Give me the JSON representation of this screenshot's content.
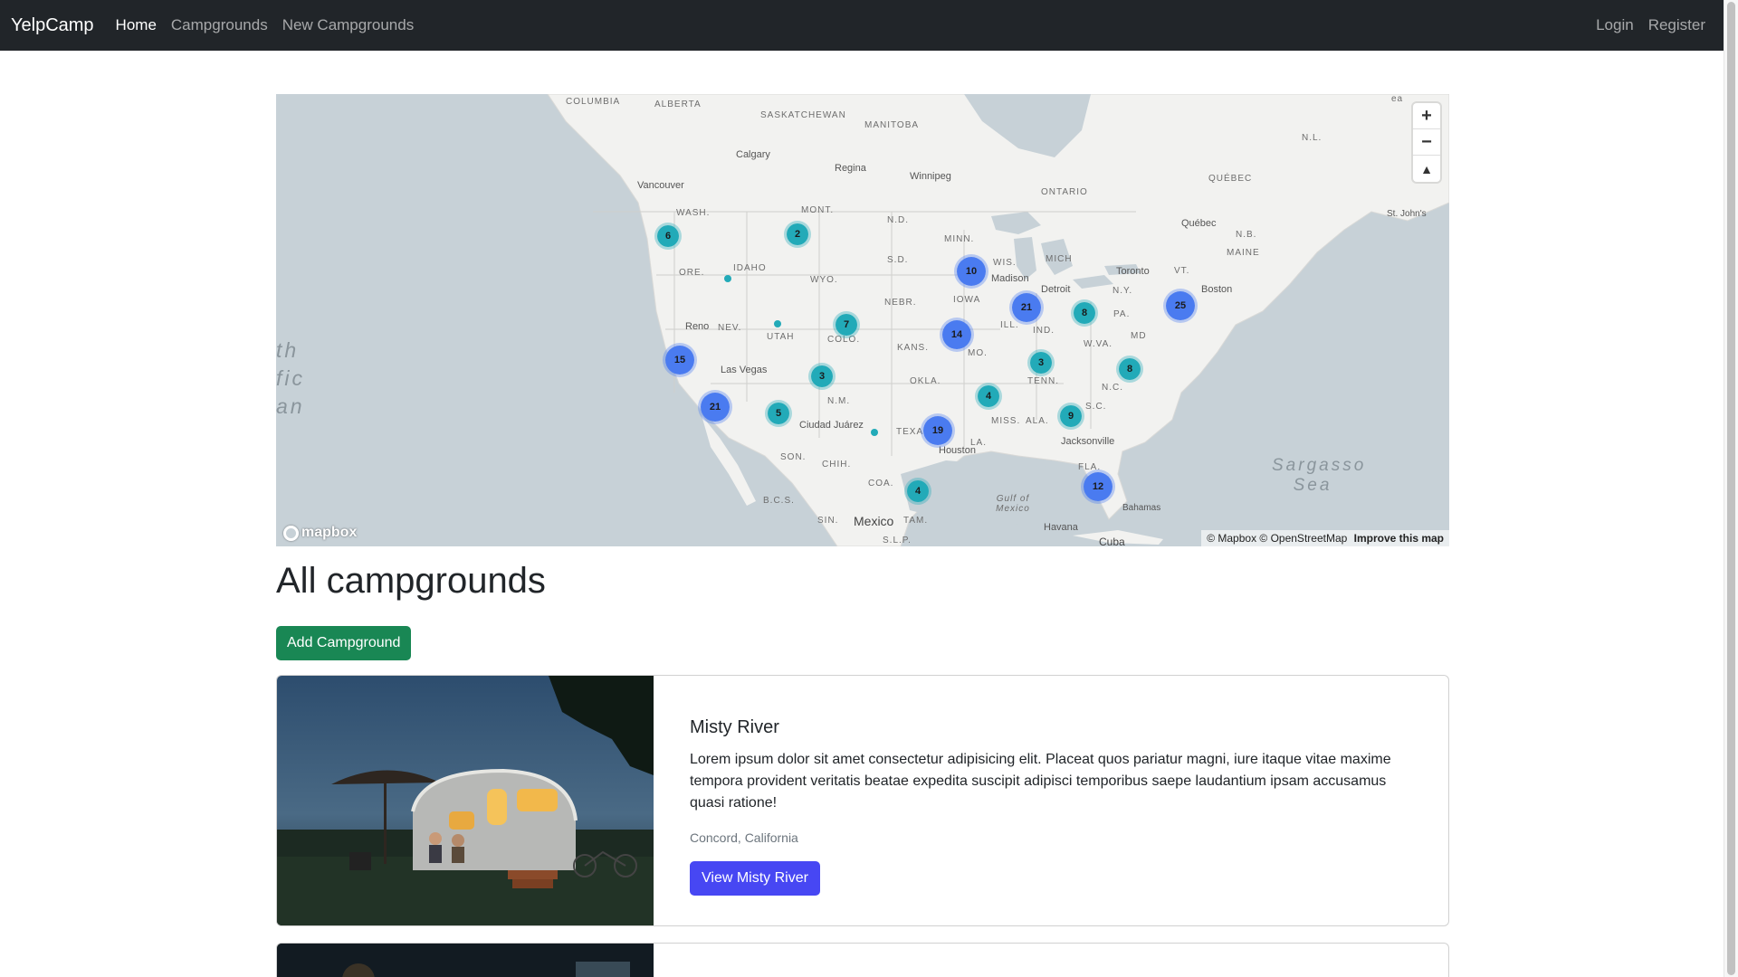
{
  "navbar": {
    "brand": "YelpCamp",
    "links": [
      {
        "label": "Home",
        "active": true
      },
      {
        "label": "Campgrounds",
        "active": false
      },
      {
        "label": "New Campgrounds",
        "active": false
      }
    ],
    "right_links": [
      "Login",
      "Register"
    ]
  },
  "map": {
    "controls": {
      "zoom_in": "+",
      "zoom_out": "−",
      "compass": "▲"
    },
    "logo": "mapbox",
    "attribution": {
      "text": "© Mapbox © OpenStreetMap",
      "improve": "Improve this map"
    },
    "labels": {
      "columbia": "COLUMBIA",
      "alberta": "ALBERTA",
      "saskatchewan": "SASKATCHEWAN",
      "manitoba": "MANITOBA",
      "ontario": "ONTARIO",
      "quebec": "QUÉBEC",
      "nl": "N.L.",
      "calgary": "Calgary",
      "regina": "Regina",
      "winnipeg": "Winnipeg",
      "vancouver": "Vancouver",
      "wash": "WASH.",
      "mont": "MONT.",
      "nd": "N.D.",
      "minn": "MINN.",
      "ore": "ORE.",
      "idaho": "IDAHO",
      "wyo": "WYO.",
      "sd": "S.D.",
      "wis": "WIS.",
      "mich": "MICH",
      "madison": "Madison",
      "detroit": "Detroit",
      "toronto": "Toronto",
      "quebec_city": "Québec",
      "nb": "N.B.",
      "maine": "MAINE",
      "vt": "VT.",
      "ny": "N.Y.",
      "boston": "Boston",
      "pa": "PA.",
      "nebr": "NEBR.",
      "iowa": "IOWA",
      "ill": "ILL.",
      "ind": "IND.",
      "reno": "Reno",
      "nev": "NEV.",
      "utah": "UTAH",
      "colo": "COLO.",
      "kans": "KANS.",
      "mo": "MO.",
      "wva": "W.VA.",
      "md": "MD",
      "lasvegas": "Las Vegas",
      "okla": "OKLA.",
      "tenn": "TENN.",
      "nc": "N.C.",
      "nm": "N.M.",
      "miss": "MISS.",
      "ala": "ALA.",
      "sc": "S.C.",
      "ciudadjuarez": "Ciudad Juárez",
      "texas": "TEXAS",
      "la": "LA.",
      "houston": "Houston",
      "jacksonville": "Jacksonville",
      "fla": "FLA.",
      "son": "SON.",
      "chih": "CHIH.",
      "coa": "COA.",
      "bc": "B.C.S.",
      "sin": "SIN.",
      "tam": "TAM.",
      "slp": "S.L.P.",
      "mexico": "Mexico",
      "gulf": "Gulf of Mexico",
      "havana": "Havana",
      "cuba": "Cuba",
      "bahamas": "Bahamas",
      "sargasso": "Sargasso Sea",
      "pacific": "th fic an",
      "stjohns": "St. John's",
      "ea": "ea",
      "nl_top": "N.L."
    },
    "clusters": [
      {
        "count": "6",
        "color": "teal"
      },
      {
        "count": "2",
        "color": "teal"
      },
      {
        "count": "10",
        "color": "blue"
      },
      {
        "count": "21",
        "color": "blue"
      },
      {
        "count": "8",
        "color": "teal"
      },
      {
        "count": "25",
        "color": "blue"
      },
      {
        "count": "7",
        "color": "teal"
      },
      {
        "count": "14",
        "color": "blue"
      },
      {
        "count": "15",
        "color": "blue"
      },
      {
        "count": "3",
        "color": "teal"
      },
      {
        "count": "3",
        "color": "teal"
      },
      {
        "count": "8",
        "color": "teal"
      },
      {
        "count": "21",
        "color": "blue"
      },
      {
        "count": "5",
        "color": "teal"
      },
      {
        "count": "4",
        "color": "teal"
      },
      {
        "count": "9",
        "color": "teal"
      },
      {
        "count": "19",
        "color": "blue"
      },
      {
        "count": "4",
        "color": "teal"
      },
      {
        "count": "12",
        "color": "blue"
      }
    ]
  },
  "page": {
    "title": "All campgrounds",
    "add_button": "Add Campground"
  },
  "campgrounds": [
    {
      "title": "Misty River",
      "description": "Lorem ipsum dolor sit amet consectetur adipisicing elit. Placeat quos pariatur magni, iure itaque vitae maxime tempora provident veritatis beatae expedita suscipit adipisci temporibus saepe laudantium ipsam accusamus quasi ratione!",
      "location": "Concord, California",
      "button": "View Misty River"
    }
  ]
}
